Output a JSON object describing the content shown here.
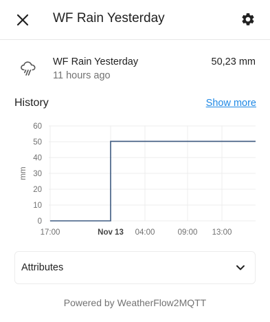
{
  "header": {
    "title": "WF Rain Yesterday",
    "close_icon": "close-icon",
    "settings_icon": "gear-icon"
  },
  "entity": {
    "icon": "weather-rainy-icon",
    "name": "WF Rain Yesterday",
    "last_changed": "11 hours ago",
    "value": "50,23 mm"
  },
  "history": {
    "title": "History",
    "show_more": "Show more"
  },
  "chart_data": {
    "type": "line",
    "ylabel": "mm",
    "yticks": [
      "0",
      "10",
      "20",
      "30",
      "40",
      "50",
      "60"
    ],
    "ylim": [
      0,
      60
    ],
    "xticks": [
      {
        "label": "17:00",
        "bold": false
      },
      {
        "label": "Nov 13",
        "bold": true
      },
      {
        "label": "04:00",
        "bold": false
      },
      {
        "label": "09:00",
        "bold": false
      },
      {
        "label": "13:00",
        "bold": false
      }
    ],
    "series": [
      {
        "color": "#3d5a80",
        "points": [
          {
            "x": "17:00",
            "y": 0
          },
          {
            "x": "Nov 13 00:00",
            "y": 0
          },
          {
            "x": "Nov 13 00:00",
            "y": 50.23
          },
          {
            "x": "Nov 13 16:00",
            "y": 50.23
          }
        ]
      }
    ],
    "grid": true
  },
  "attributes": {
    "label": "Attributes",
    "chevron_icon": "chevron-down-icon"
  },
  "footer": {
    "text": "Powered by WeatherFlow2MQTT"
  },
  "colors": {
    "accent": "#1e88e5",
    "line": "#3d5a80",
    "secondary_text": "#727272"
  }
}
